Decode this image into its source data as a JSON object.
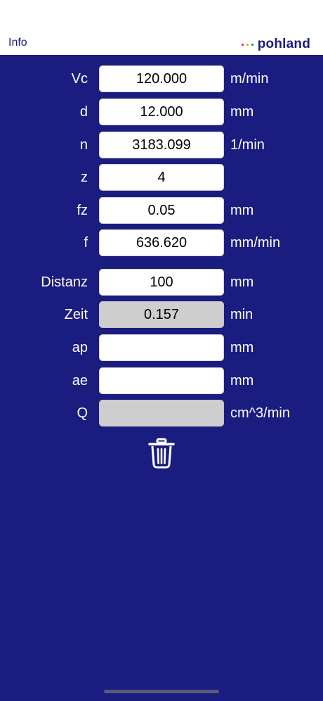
{
  "header": {
    "info_label": "Info",
    "logo_text": "pohland",
    "logo_dot_colors": [
      "#e5322d",
      "#f3a51d",
      "#2a8c3c"
    ]
  },
  "colors": {
    "background": "#1b1c80",
    "field": "#ffffff",
    "field_readonly": "#cecece"
  },
  "rows": [
    {
      "label": "Vc",
      "value": "120.000",
      "unit": "m/min"
    },
    {
      "label": "d",
      "value": "12.000",
      "unit": "mm"
    },
    {
      "label": "n",
      "value": "3183.099",
      "unit": "1/min"
    },
    {
      "label": "z",
      "value": "4",
      "unit": ""
    },
    {
      "label": "fz",
      "value": "0.05",
      "unit": "mm"
    },
    {
      "label": "f",
      "value": "636.620",
      "unit": "mm/min"
    },
    {
      "label": "Distanz",
      "value": "100",
      "unit": "mm"
    },
    {
      "label": "Zeit",
      "value": "0.157",
      "unit": "min"
    },
    {
      "label": "ap",
      "value": "",
      "unit": "mm"
    },
    {
      "label": "ae",
      "value": "",
      "unit": "mm"
    },
    {
      "label": "Q",
      "value": "",
      "unit": "cm^3/min"
    }
  ],
  "actions": {
    "clear_icon": "trash-icon"
  }
}
